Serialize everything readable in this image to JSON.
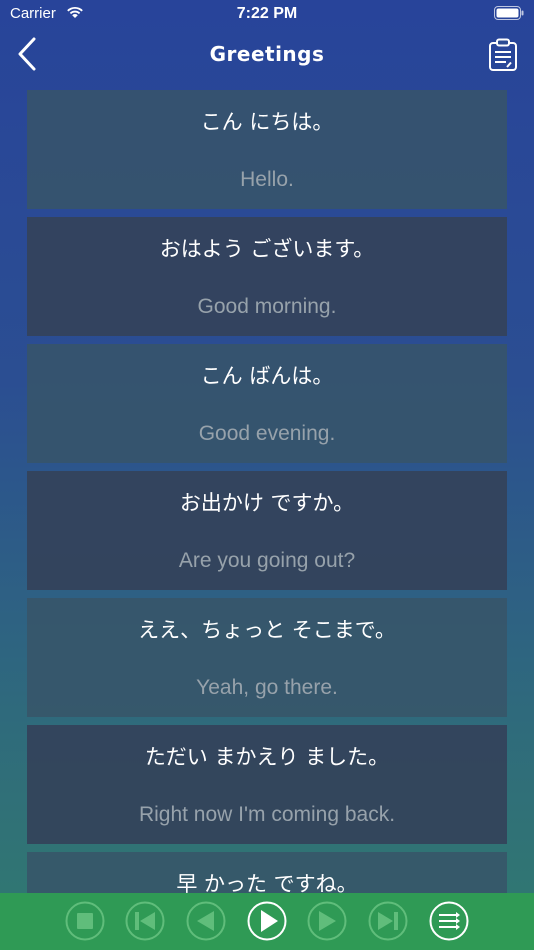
{
  "status": {
    "carrier": "Carrier",
    "time": "7:22 PM"
  },
  "nav": {
    "title": "Greetings",
    "back_icon": "chevron-left-icon",
    "action_icon": "clipboard-icon"
  },
  "phrases": [
    {
      "jp": "こん にちは。",
      "en": "Hello."
    },
    {
      "jp": "おはよう ございます。",
      "en": "Good morning."
    },
    {
      "jp": "こん ばんは。",
      "en": "Good evening."
    },
    {
      "jp": "お出かけ ですか。",
      "en": "Are you going out?"
    },
    {
      "jp": "ええ、ちょっと そこまで。",
      "en": "Yeah, go there."
    },
    {
      "jp": "ただい まかえり ました。",
      "en": "Right now I'm coming back."
    },
    {
      "jp": "早 かった ですね。",
      "en": ""
    }
  ],
  "player": {
    "buttons": [
      "stop-icon",
      "skip-to-start-icon",
      "previous-icon",
      "play-icon",
      "next-icon",
      "skip-to-end-icon",
      "playlist-icon"
    ]
  },
  "colors": {
    "background_top": "#28449a",
    "background_bottom": "#317a70",
    "card_light": "#375569",
    "card_dark": "#34425a",
    "translation_text": "#97a2ab",
    "player_bar": "#2f9a55"
  }
}
